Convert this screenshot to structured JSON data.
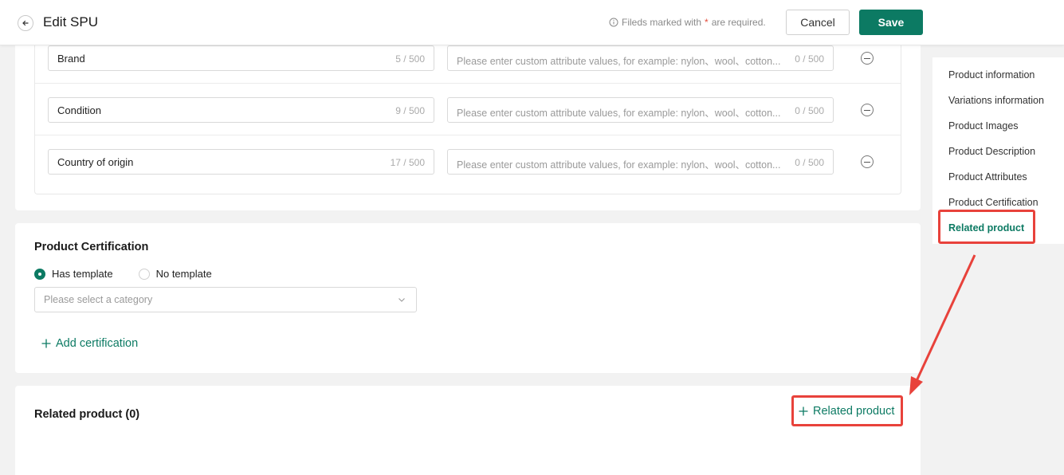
{
  "header": {
    "title": "Edit SPU",
    "required_note_prefix": "Fileds marked with",
    "required_star": "*",
    "required_note_suffix": "are required.",
    "cancel_label": "Cancel",
    "save_label": "Save"
  },
  "attributes": {
    "rows": [
      {
        "name": "Brand",
        "name_count": "5 / 500",
        "value_placeholder": "Please enter custom attribute values, for example: nylon、wool、cotton...",
        "value_count": "0 / 500"
      },
      {
        "name": "Condition",
        "name_count": "9 / 500",
        "value_placeholder": "Please enter custom attribute values, for example: nylon、wool、cotton...",
        "value_count": "0 / 500"
      },
      {
        "name": "Country of origin",
        "name_count": "17 / 500",
        "value_placeholder": "Please enter custom attribute values, for example: nylon、wool、cotton...",
        "value_count": "0 / 500"
      }
    ]
  },
  "certification": {
    "title": "Product Certification",
    "radio_has_template": "Has template",
    "radio_no_template": "No template",
    "selected": "Has template",
    "select_placeholder": "Please select a category",
    "add_label": "Add certification"
  },
  "related": {
    "title": "Related product (0)",
    "add_label": "Related product"
  },
  "side_nav": {
    "items": [
      {
        "label": "Product information"
      },
      {
        "label": "Variations information"
      },
      {
        "label": "Product Images"
      },
      {
        "label": "Product Description"
      },
      {
        "label": "Product Attributes"
      },
      {
        "label": "Product Certification"
      },
      {
        "label": "Related product"
      }
    ],
    "active": "Related product"
  },
  "colors": {
    "accent": "#0c7a63",
    "annotation": "#e8423b",
    "background": "#f2f2f2"
  }
}
